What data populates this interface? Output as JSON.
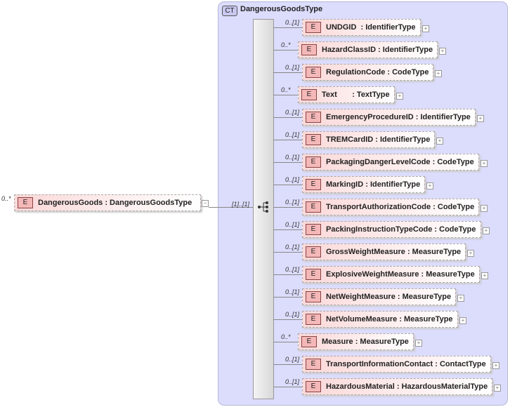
{
  "root": {
    "cardinality": "0..*",
    "badge": "E",
    "label": "DangerousGoods : DangerousGoodsType",
    "link_cardinality": "[1]..[1]"
  },
  "complex_type": {
    "badge": "CT",
    "title": "DangerousGoodsType"
  },
  "elements": [
    {
      "card": "0..[1]",
      "label": "UNDGID  : IdentifierType"
    },
    {
      "card": "0..*",
      "label": "HazardClassID : IdentifierType"
    },
    {
      "card": "0..[1]",
      "label": "RegulationCode : CodeType"
    },
    {
      "card": "0..*",
      "label": "Text       : TextType"
    },
    {
      "card": "0..[1]",
      "label": "EmergencyProcedureID : IdentifierType"
    },
    {
      "card": "0..[1]",
      "label": "TREMCardID : IdentifierType"
    },
    {
      "card": "0..[1]",
      "label": "PackagingDangerLevelCode : CodeType"
    },
    {
      "card": "0..[1]",
      "label": "MarkingID : IdentifierType"
    },
    {
      "card": "0..[1]",
      "label": "TransportAuthorizationCode : CodeType"
    },
    {
      "card": "0..[1]",
      "label": "PackingInstructionTypeCode : CodeType"
    },
    {
      "card": "0..[1]",
      "label": "GrossWeightMeasure : MeasureType"
    },
    {
      "card": "0..[1]",
      "label": "ExplosiveWeightMeasure : MeasureType"
    },
    {
      "card": "0..[1]",
      "label": "NetWeightMeasure : MeasureType"
    },
    {
      "card": "0..[1]",
      "label": "NetVolumeMeasure : MeasureType"
    },
    {
      "card": "0..*",
      "label": "Measure : MeasureType"
    },
    {
      "card": "0..[1]",
      "label": "TransportInformationContact : ContactType"
    },
    {
      "card": "0..[1]",
      "label": "HazardousMaterial : HazardousMaterialType"
    }
  ]
}
